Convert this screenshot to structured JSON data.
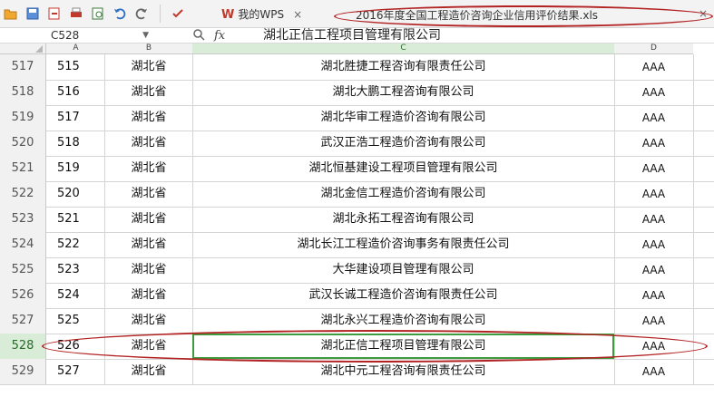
{
  "toolbar": {
    "icons": [
      "folder-open-icon",
      "save-icon",
      "export-icon",
      "print-icon",
      "print-preview-icon",
      "undo-icon",
      "redo-icon"
    ],
    "wps_tab_label": "我的WPS",
    "file_tab_label": "2016年度全国工程造价咨询企业信用评价结果.xls",
    "close_glyph": "×"
  },
  "formula_bar": {
    "cell_ref": "C528",
    "fx_label": "fx",
    "formula_value": "湖北正信工程项目管理有限公司"
  },
  "columns": [
    "A",
    "B",
    "C",
    "D"
  ],
  "rows": [
    {
      "n": "517",
      "a": "515",
      "b": "湖北省",
      "c": "湖北胜捷工程咨询有限责任公司",
      "d": "AAA"
    },
    {
      "n": "518",
      "a": "516",
      "b": "湖北省",
      "c": "湖北大鹏工程咨询有限公司",
      "d": "AAA"
    },
    {
      "n": "519",
      "a": "517",
      "b": "湖北省",
      "c": "湖北华审工程造价咨询有限公司",
      "d": "AAA"
    },
    {
      "n": "520",
      "a": "518",
      "b": "湖北省",
      "c": "武汉正浩工程造价咨询有限公司",
      "d": "AAA"
    },
    {
      "n": "521",
      "a": "519",
      "b": "湖北省",
      "c": "湖北恒基建设工程项目管理有限公司",
      "d": "AAA"
    },
    {
      "n": "522",
      "a": "520",
      "b": "湖北省",
      "c": "湖北金信工程造价咨询有限公司",
      "d": "AAA"
    },
    {
      "n": "523",
      "a": "521",
      "b": "湖北省",
      "c": "湖北永拓工程咨询有限公司",
      "d": "AAA"
    },
    {
      "n": "524",
      "a": "522",
      "b": "湖北省",
      "c": "湖北长江工程造价咨询事务有限责任公司",
      "d": "AAA"
    },
    {
      "n": "525",
      "a": "523",
      "b": "湖北省",
      "c": "大华建设项目管理有限公司",
      "d": "AAA"
    },
    {
      "n": "526",
      "a": "524",
      "b": "湖北省",
      "c": "武汉长诚工程造价咨询有限责任公司",
      "d": "AAA"
    },
    {
      "n": "527",
      "a": "525",
      "b": "湖北省",
      "c": "湖北永兴工程造价咨询有限公司",
      "d": "AAA"
    },
    {
      "n": "528",
      "a": "526",
      "b": "湖北省",
      "c": "湖北正信工程项目管理有限公司",
      "d": "AAA"
    },
    {
      "n": "529",
      "a": "527",
      "b": "湖北省",
      "c": "湖北中元工程咨询有限责任公司",
      "d": "AAA"
    }
  ],
  "selected_row": "528",
  "colors": {
    "highlight_ellipse": "#b22222",
    "active_cell_border": "#3f9b3f"
  }
}
